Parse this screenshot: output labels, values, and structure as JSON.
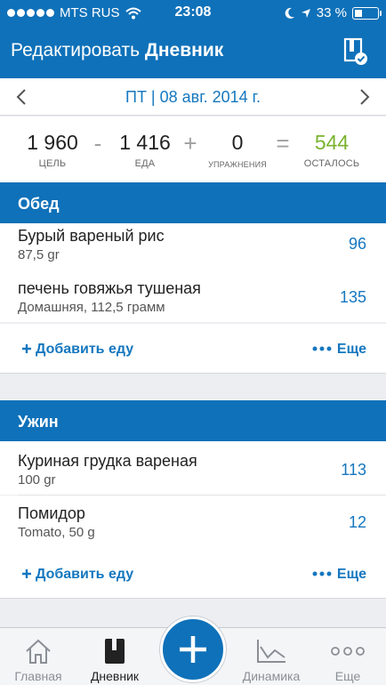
{
  "status_bar": {
    "carrier": "MTS RUS",
    "time": "23:08",
    "battery": "33 %",
    "battery_fraction": 0.33
  },
  "header": {
    "title_prefix": "Редактировать",
    "title_main": "Дневник",
    "icon": "diary-check-icon"
  },
  "date_nav": {
    "date": "ПТ | 08 авг. 2014 г.",
    "prev_icon": "chevron-left-icon",
    "next_icon": "chevron-right-icon"
  },
  "summary": {
    "goal": {
      "value": "1 960",
      "label": "ЦЕЛЬ"
    },
    "food": {
      "value": "1 416",
      "label": "ЕДА"
    },
    "exercise": {
      "value": "0",
      "label": "УПРАЖНЕНИЯ"
    },
    "remaining": {
      "value": "544",
      "label": "ОСТАЛОСЬ"
    },
    "ops": {
      "minus": "-",
      "plus": "+",
      "equals": "="
    },
    "remaining_color": "#7ab32e"
  },
  "meals": [
    {
      "title": "Обед",
      "items": [
        {
          "name": "Бурый вареный рис",
          "detail": "87,5 gr",
          "calories": "96"
        },
        {
          "name": "печень говяжья тушеная",
          "detail": "Домашняя, 112,5 грамм",
          "calories": "135"
        }
      ],
      "add_label": "Добавить еду",
      "more_label": "Еще"
    },
    {
      "title": "Ужин",
      "items": [
        {
          "name": "Куриная грудка вареная",
          "detail": "100 gr",
          "calories": "113"
        },
        {
          "name": "Помидор",
          "detail": "Tomato, 50 g",
          "calories": "12"
        }
      ],
      "add_label": "Добавить еду",
      "more_label": "Еще"
    }
  ],
  "tabs": [
    {
      "label": "Главная",
      "icon": "home-icon",
      "active": false
    },
    {
      "label": "Дневник",
      "icon": "diary-icon",
      "active": true
    },
    {
      "label": "Динамика",
      "icon": "chart-icon",
      "active": false
    },
    {
      "label": "Еще",
      "icon": "more-icon",
      "active": false
    }
  ],
  "colors": {
    "brand": "#0f71b9",
    "link": "#1577bf",
    "remaining": "#7ab32e"
  }
}
